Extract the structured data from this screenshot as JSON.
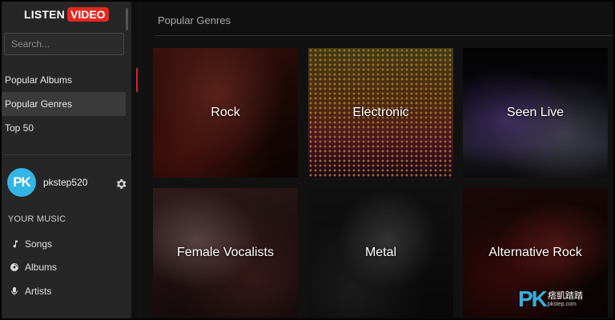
{
  "app": {
    "logo_word1": "LISTEN",
    "logo_word2": "VIDEO",
    "brand_color": "#e5271f"
  },
  "search": {
    "placeholder": "Search..."
  },
  "nav": {
    "items": [
      {
        "label": "Popular Albums"
      },
      {
        "label": "Popular Genres"
      },
      {
        "label": "Top 50"
      }
    ]
  },
  "user": {
    "avatar_text": "PK",
    "avatar_color": "#33b5e5",
    "name": "pkstep520",
    "settings_icon": "gear-icon"
  },
  "your_music": {
    "label": "YOUR MUSIC",
    "items": [
      {
        "label": "Songs",
        "icon": "music-note-icon"
      },
      {
        "label": "Albums",
        "icon": "disc-icon"
      },
      {
        "label": "Artists",
        "icon": "microphone-icon"
      }
    ]
  },
  "main": {
    "title": "Popular Genres",
    "genres": [
      {
        "label": "Rock"
      },
      {
        "label": "Electronic"
      },
      {
        "label": "Seen Live"
      },
      {
        "label": "Female Vocalists"
      },
      {
        "label": "Metal"
      },
      {
        "label": "Alternative Rock"
      }
    ]
  },
  "watermark": {
    "logo": "PK",
    "cn": "痞凱踏踏",
    "url": "pkstep.com"
  }
}
